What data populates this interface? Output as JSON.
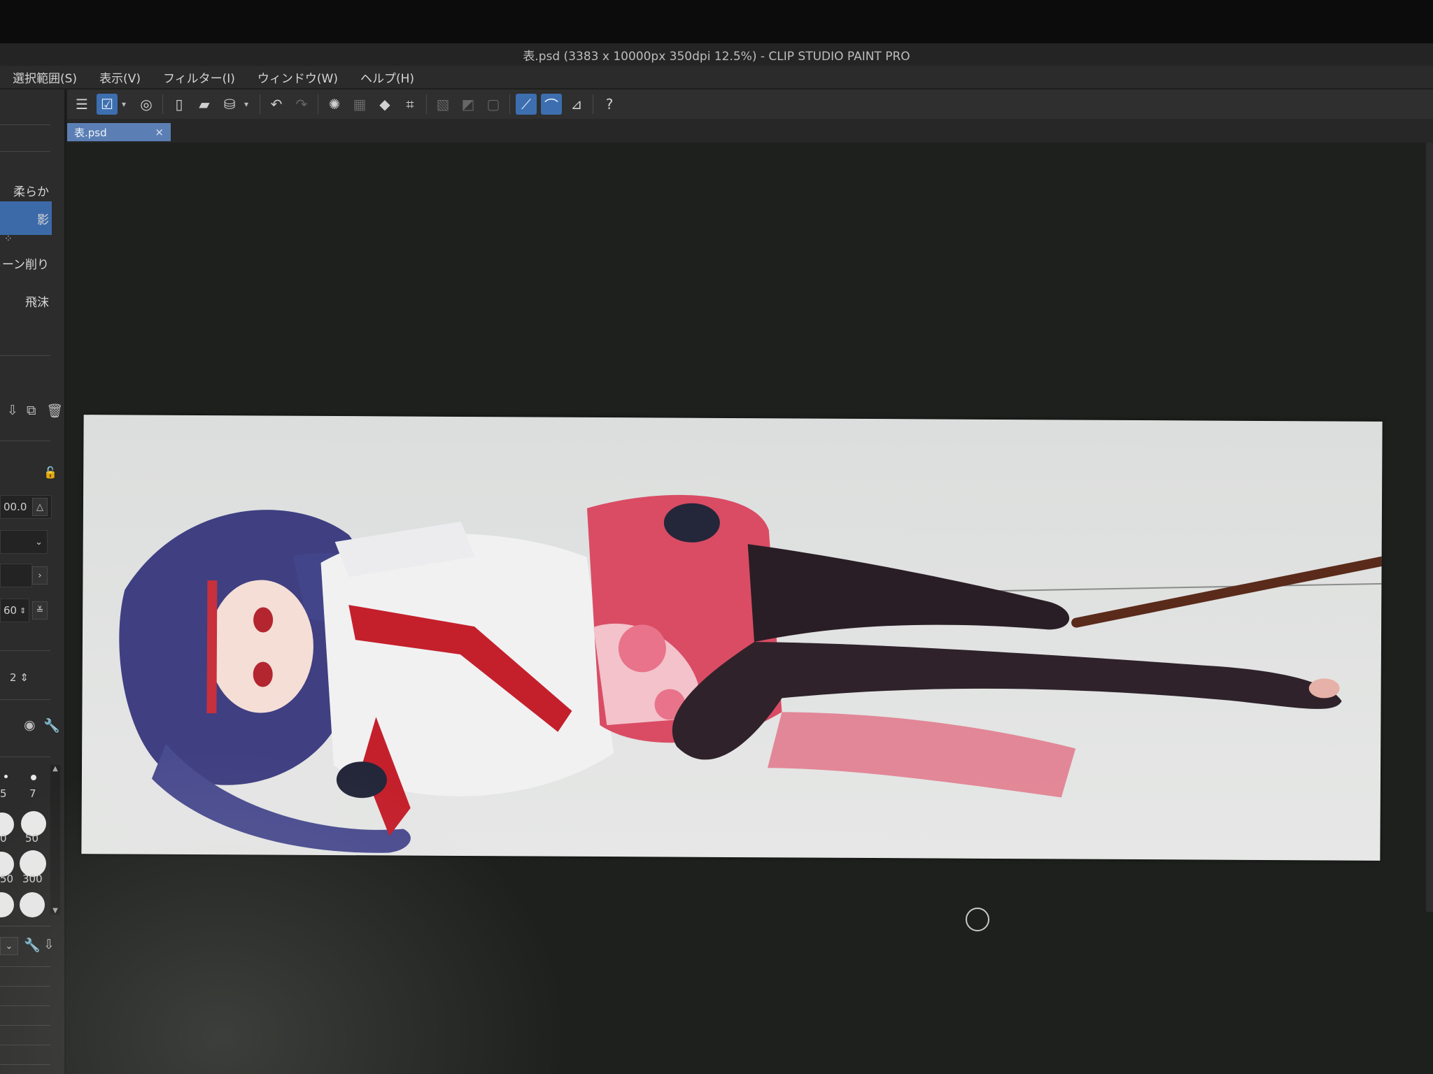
{
  "window": {
    "title": "表.psd (3383 x 10000px 350dpi 12.5%) - CLIP STUDIO PAINT PRO"
  },
  "menu": [
    "選択範囲(S)",
    "表示(V)",
    "フィルター(I)",
    "ウィンドウ(W)",
    "ヘルプ(H)"
  ],
  "document_tab": {
    "label": "表.psd",
    "close": "×"
  },
  "subtools": [
    "柔らか",
    "影",
    "トーン削り",
    "飛沫"
  ],
  "properties": {
    "size_value": "00.0",
    "density_value": "60",
    "stepper_value": "2"
  },
  "brush_sizes": [
    "5",
    "7",
    "0",
    "50",
    "50",
    "300"
  ],
  "colors": {
    "accent": "#3d6fb0",
    "panel": "#2b2c2b",
    "canvas_bg": "#1e201e",
    "skirt": "#d94c64",
    "hair": "#3f3f82",
    "tights": "#2a1e26"
  }
}
